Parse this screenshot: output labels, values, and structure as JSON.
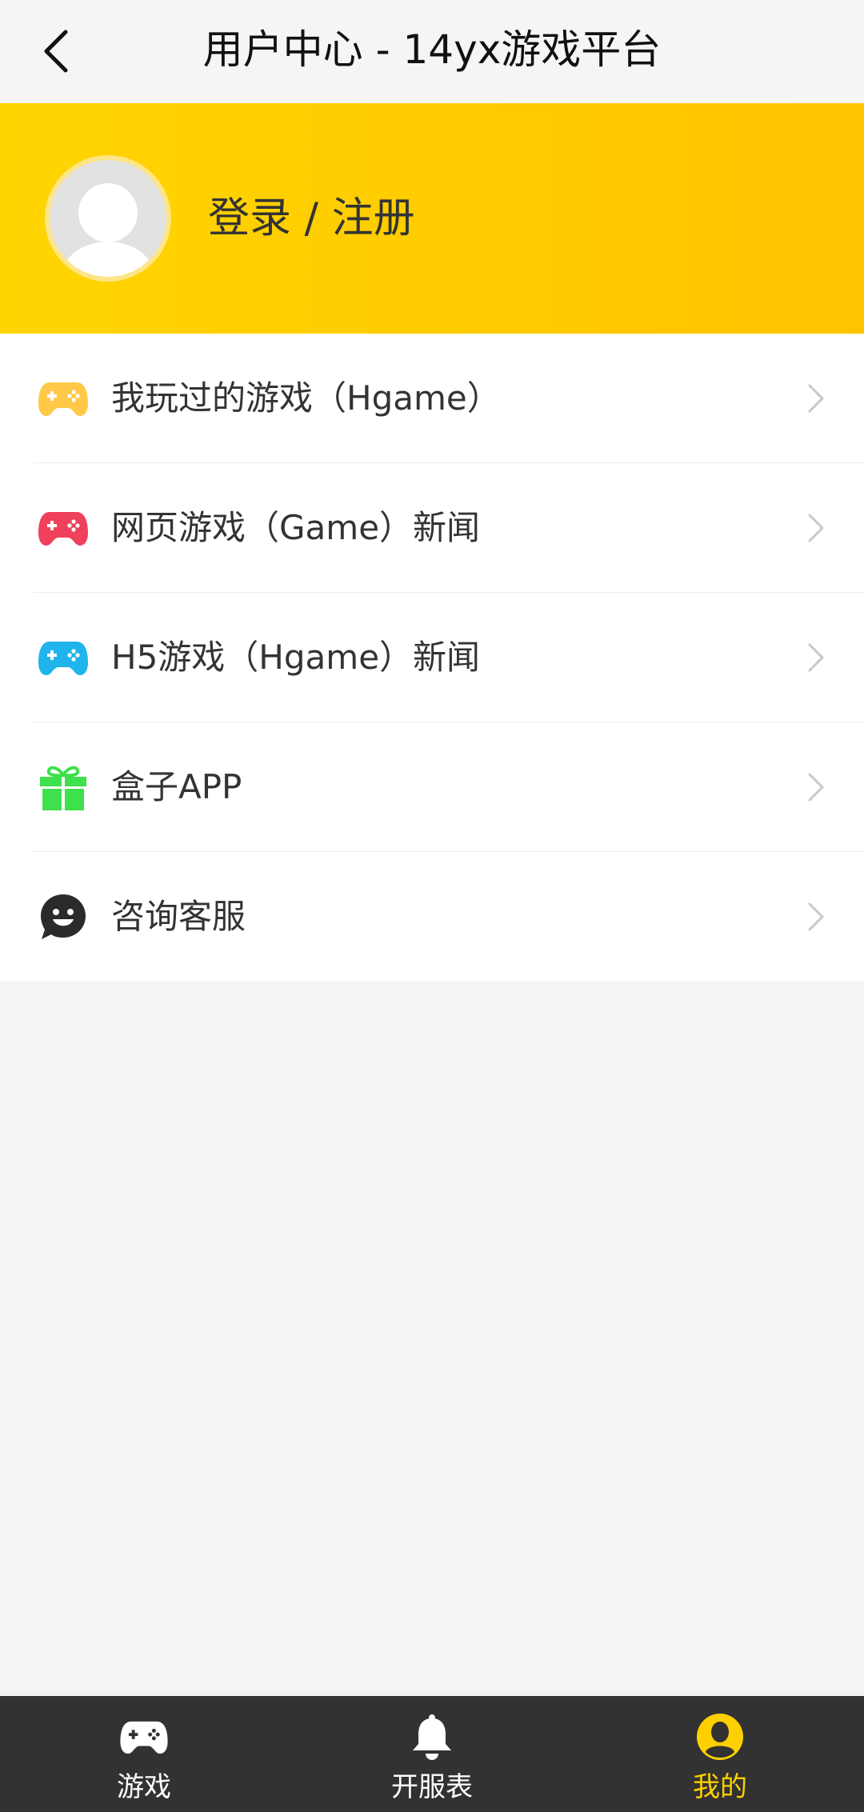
{
  "header": {
    "title": "用户中心 - 14yx游戏平台",
    "back_icon": "chevron-left-icon"
  },
  "profile": {
    "login_label": "登录 / 注册",
    "avatar_icon": "user-avatar-icon"
  },
  "menu": {
    "items": [
      {
        "label": "我玩过的游戏（Hgame）",
        "icon": "gamepad-icon",
        "color": "#ffc847"
      },
      {
        "label": "网页游戏（Game）新闻",
        "icon": "gamepad-icon",
        "color": "#f0415c"
      },
      {
        "label": "H5游戏（Hgame）新闻",
        "icon": "gamepad-icon",
        "color": "#1fb5ec"
      },
      {
        "label": "盒子APP",
        "icon": "gift-icon",
        "color": "#3ee04b"
      },
      {
        "label": "咨询客服",
        "icon": "smiley-chat-icon",
        "color": "#2b2b2b"
      }
    ]
  },
  "bottom_nav": {
    "items": [
      {
        "label": "游戏",
        "icon": "gamepad-icon",
        "active": false
      },
      {
        "label": "开服表",
        "icon": "bell-icon",
        "active": false
      },
      {
        "label": "我的",
        "icon": "user-icon",
        "active": true
      }
    ],
    "active_color": "#ffd000"
  },
  "colors": {
    "banner_start": "#ffd500",
    "banner_end": "#ffc300",
    "nav_background": "#323232"
  }
}
